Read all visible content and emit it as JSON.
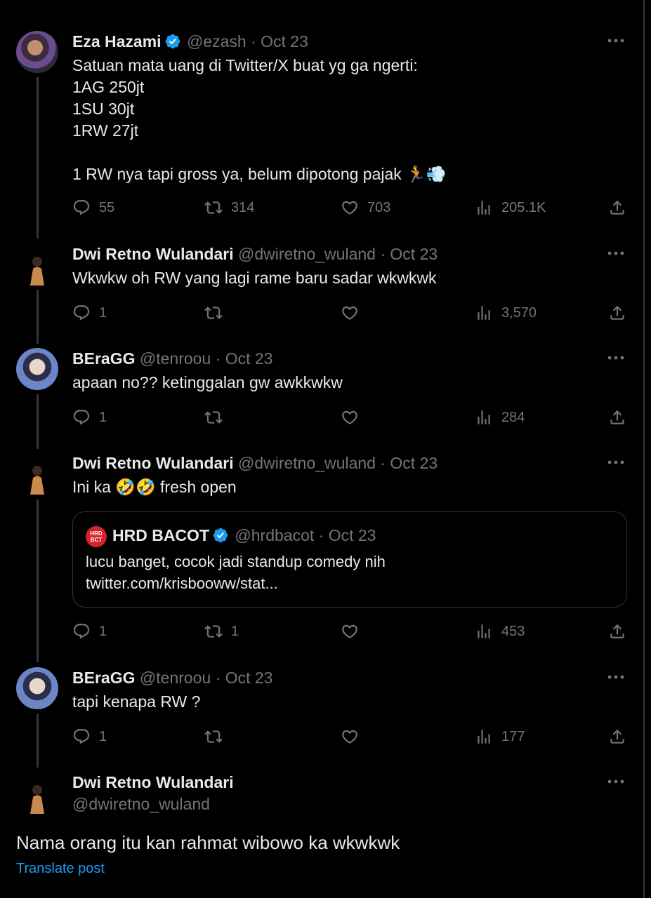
{
  "tweets": [
    {
      "name": "Eza Hazami",
      "verified": true,
      "handle": "@ezash",
      "sep": "·",
      "date": "Oct 23",
      "text": "Satuan mata uang di Twitter/X buat yg ga ngerti:\n1AG 250jt\n1SU 30jt\n1RW 27jt\n\n1 RW nya tapi gross ya, belum dipotong pajak 🏃💨",
      "replies": "55",
      "retweets": "314",
      "likes": "703",
      "views": "205.1K"
    },
    {
      "name": "Dwi Retno Wulandari",
      "handle": "@dwiretno_wuland",
      "sep": "·",
      "date": "Oct 23",
      "text": "Wkwkw oh RW yang  lagi rame baru sadar wkwkwk",
      "replies": "1",
      "retweets": "",
      "likes": "",
      "views": "3,570"
    },
    {
      "name": "BEraGG",
      "handle": "@tenroou",
      "sep": "·",
      "date": "Oct 23",
      "text": "apaan no?? ketinggalan gw awkkwkw",
      "replies": "1",
      "retweets": "",
      "likes": "",
      "views": "284"
    },
    {
      "name": "Dwi Retno Wulandari",
      "handle": "@dwiretno_wuland",
      "sep": "·",
      "date": "Oct 23",
      "text": "Ini ka 🤣🤣 fresh open",
      "quote": {
        "logo_text": "HRD BCT",
        "name": "HRD BACOT",
        "verified": true,
        "handle": "@hrdbacot",
        "sep": "·",
        "date": "Oct 23",
        "text": "lucu banget, cocok jadi standup comedy nih",
        "link": "twitter.com/krisbooww/stat..."
      },
      "replies": "1",
      "retweets": "1",
      "likes": "",
      "views": "453"
    },
    {
      "name": "BEraGG",
      "handle": "@tenroou",
      "sep": "·",
      "date": "Oct 23",
      "text": "tapi kenapa RW ?",
      "replies": "1",
      "retweets": "",
      "likes": "",
      "views": "177"
    }
  ],
  "focused": {
    "name": "Dwi Retno Wulandari",
    "handle": "@dwiretno_wuland",
    "text": "Nama orang itu kan rahmat wibowo ka wkwkwk",
    "translate": "Translate post"
  },
  "colors": {
    "background": "#000000",
    "text": "#e7e9ea",
    "muted": "#71767b",
    "accent": "#1d9bf0",
    "border": "#2f3336"
  }
}
